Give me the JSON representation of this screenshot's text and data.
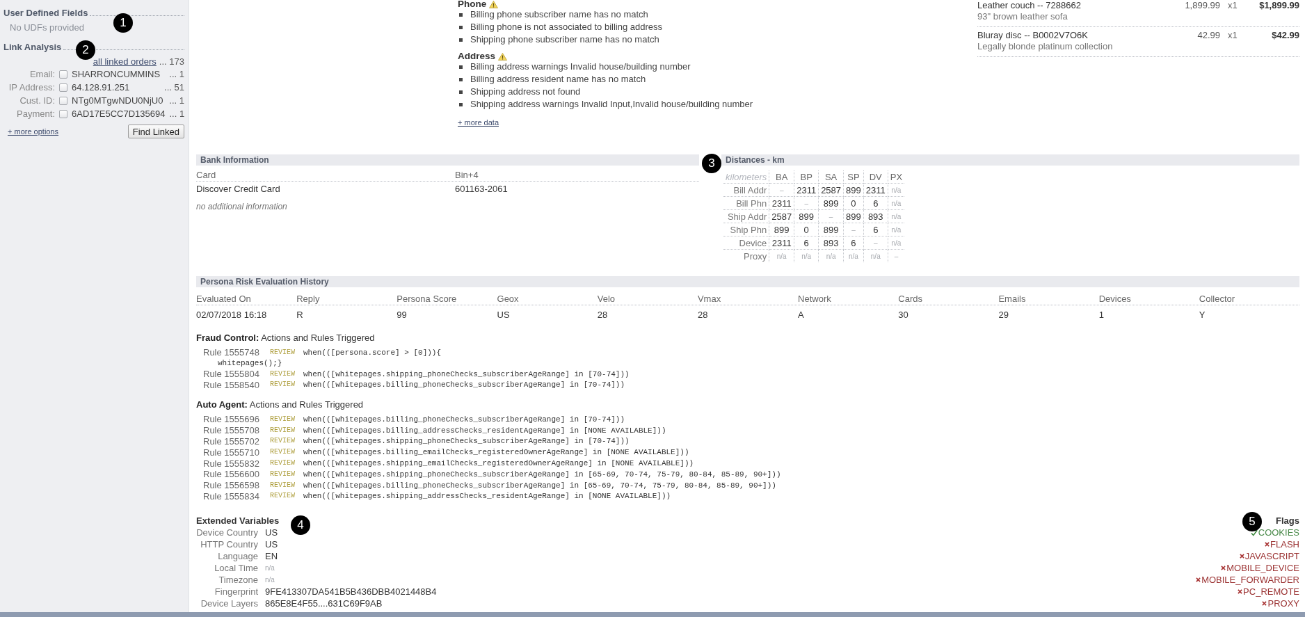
{
  "sidebar": {
    "udf": {
      "title": "User Defined Fields",
      "empty_text": "No UDFs provided"
    },
    "link_analysis": {
      "title": "Link Analysis",
      "all_link": "all linked orders",
      "all_count": "... 173",
      "rows": [
        {
          "label": "Email:",
          "checked": false,
          "value": "SHARRONCUMMINS",
          "count": "... 1"
        },
        {
          "label": "IP Address:",
          "checked": false,
          "value": "64.128.91.251",
          "count": "... 51"
        },
        {
          "label": "Cust. ID:",
          "checked": false,
          "value": "NTg0MTgwNDU0NjU0",
          "count": "... 1"
        },
        {
          "label": "Payment:",
          "checked": false,
          "value": "6AD17E5CC7D135694",
          "count": "... 1"
        }
      ],
      "more_link": "+ more options",
      "button": "Find Linked"
    }
  },
  "risk_checks": {
    "groups": [
      {
        "title": "Phone",
        "warning": true,
        "items": [
          "Billing phone subscriber name has no match",
          "Billing phone is not associated to billing address",
          "Shipping phone subscriber name has no match"
        ]
      },
      {
        "title": "Address",
        "warning": true,
        "items": [
          "Billing address warnings Invalid house/building number",
          "Billing address resident name has no match",
          "Shipping address not found",
          "Shipping address warnings Invalid Input,Invalid house/building number"
        ]
      }
    ],
    "more_link": "+ more data"
  },
  "order_items": [
    {
      "name": "Leather couch -- 7288662",
      "description": "93\" brown leather sofa",
      "price": "1,899.99",
      "qty": "x1",
      "total": "$1,899.99"
    },
    {
      "name": "Bluray disc -- B0002V7O6K",
      "description": "Legally blonde platinum collection",
      "price": "42.99",
      "qty": "x1",
      "total": "$42.99"
    }
  ],
  "bank_information": {
    "title": "Bank Information",
    "columns": [
      "Card",
      "Bin+4"
    ],
    "rows": [
      [
        "Discover Credit Card",
        "601163-2061"
      ]
    ],
    "note": "no additional information"
  },
  "distances": {
    "title": "Distances - km",
    "corner": "kilometers",
    "columns": [
      "BA",
      "BP",
      "SA",
      "SP",
      "DV",
      "PX"
    ],
    "rows": [
      {
        "label": "Bill Addr",
        "cells": [
          {
            "text": "–",
            "muted": true
          },
          {
            "text": "2311",
            "muted": false
          },
          {
            "text": "2587",
            "muted": false
          },
          {
            "text": "899",
            "muted": false
          },
          {
            "text": "2311",
            "muted": false
          },
          {
            "text": "n/a",
            "muted": true
          }
        ]
      },
      {
        "label": "Bill Phn",
        "cells": [
          {
            "text": "2311",
            "muted": false
          },
          {
            "text": "–",
            "muted": true
          },
          {
            "text": "899",
            "muted": false
          },
          {
            "text": "0",
            "muted": false
          },
          {
            "text": "6",
            "muted": false
          },
          {
            "text": "n/a",
            "muted": true
          }
        ]
      },
      {
        "label": "Ship Addr",
        "cells": [
          {
            "text": "2587",
            "muted": false
          },
          {
            "text": "899",
            "muted": false
          },
          {
            "text": "–",
            "muted": true
          },
          {
            "text": "899",
            "muted": false
          },
          {
            "text": "893",
            "muted": false
          },
          {
            "text": "n/a",
            "muted": true
          }
        ]
      },
      {
        "label": "Ship Phn",
        "cells": [
          {
            "text": "899",
            "muted": false
          },
          {
            "text": "0",
            "muted": false
          },
          {
            "text": "899",
            "muted": false
          },
          {
            "text": "–",
            "muted": true
          },
          {
            "text": "6",
            "muted": false
          },
          {
            "text": "n/a",
            "muted": true
          }
        ]
      },
      {
        "label": "Device",
        "cells": [
          {
            "text": "2311",
            "muted": false
          },
          {
            "text": "6",
            "muted": false
          },
          {
            "text": "893",
            "muted": false
          },
          {
            "text": "6",
            "muted": false
          },
          {
            "text": "–",
            "muted": true
          },
          {
            "text": "n/a",
            "muted": true
          }
        ]
      },
      {
        "label": "Proxy",
        "cells": [
          {
            "text": "n/a",
            "muted": true
          },
          {
            "text": "n/a",
            "muted": true
          },
          {
            "text": "n/a",
            "muted": true
          },
          {
            "text": "n/a",
            "muted": true
          },
          {
            "text": "n/a",
            "muted": true
          },
          {
            "text": "–",
            "muted": true
          }
        ]
      }
    ]
  },
  "persona_history": {
    "title": "Persona Risk Evaluation History",
    "columns": [
      "Evaluated On",
      "Reply",
      "Persona Score",
      "Geox",
      "Velo",
      "Vmax",
      "Network",
      "Cards",
      "Emails",
      "Devices",
      "Collector"
    ],
    "rows": [
      [
        "02/07/2018 16:18",
        "R",
        "99",
        "US",
        "28",
        "28",
        "A",
        "30",
        "29",
        "1",
        "Y"
      ]
    ]
  },
  "rule_groups": [
    {
      "title": "**Fraud Control:** Actions and Rules Triggered",
      "rules": [
        {
          "rule": "Rule 1555748",
          "action": "REVIEW",
          "code": [
            "when(([persona.score] > [0])){",
            "whitepages();}"
          ]
        },
        {
          "rule": "Rule 1555804",
          "action": "REVIEW",
          "code": [
            "when(([whitepages.shipping_phoneChecks_subscriberAgeRange] in [70-74]))"
          ]
        },
        {
          "rule": "Rule 1558540",
          "action": "REVIEW",
          "code": [
            "when(([whitepages.billing_phoneChecks_subscriberAgeRange] in [70-74]))"
          ]
        }
      ]
    },
    {
      "title": "**Auto Agent:** Actions and Rules Triggered",
      "rules": [
        {
          "rule": "Rule 1555696",
          "action": "REVIEW",
          "code": [
            "when(([whitepages.billing_phoneChecks_subscriberAgeRange] in [70-74]))"
          ]
        },
        {
          "rule": "Rule 1555708",
          "action": "REVIEW",
          "code": [
            "when(([whitepages.billing_addressChecks_residentAgeRange] in [NONE AVAILABLE]))"
          ]
        },
        {
          "rule": "Rule 1555702",
          "action": "REVIEW",
          "code": [
            "when(([whitepages.shipping_phoneChecks_subscriberAgeRange] in [70-74]))"
          ]
        },
        {
          "rule": "Rule 1555710",
          "action": "REVIEW",
          "code": [
            "when(([whitepages.billing_emailChecks_registeredOwnerAgeRange] in [NONE AVAILABLE]))"
          ]
        },
        {
          "rule": "Rule 1555832",
          "action": "REVIEW",
          "code": [
            "when(([whitepages.shipping_emailChecks_registeredOwnerAgeRange] in [NONE AVAILABLE]))"
          ]
        },
        {
          "rule": "Rule 1556600",
          "action": "REVIEW",
          "code": [
            "when(([whitepages.shipping_phoneChecks_subscriberAgeRange] in [65-69, 70-74, 75-79, 80-84, 85-89, 90+]))"
          ]
        },
        {
          "rule": "Rule 1556598",
          "action": "REVIEW",
          "code": [
            "when(([whitepages.billing_phoneChecks_subscriberAgeRange] in [65-69, 70-74, 75-79, 80-84, 85-89, 90+]))"
          ]
        },
        {
          "rule": "Rule 1555834",
          "action": "REVIEW",
          "code": [
            "when(([whitepages.shipping_addressChecks_residentAgeRange] in [NONE AVAILABLE]))"
          ]
        }
      ]
    }
  ],
  "extended_variables": {
    "title": "Extended Variables",
    "rows": [
      {
        "label": "Device Country",
        "value": "US",
        "muted": false
      },
      {
        "label": "HTTP Country",
        "value": "US",
        "muted": false
      },
      {
        "label": "Language",
        "value": "EN",
        "muted": false
      },
      {
        "label": "Local Time",
        "value": "n/a",
        "muted": true
      },
      {
        "label": "Timezone",
        "value": "n/a",
        "muted": true
      },
      {
        "label": "Fingerprint",
        "value": "9FE413307DA541B5B436DBB4021448B4",
        "muted": false
      },
      {
        "label": "Device Layers",
        "value": "865E8E4F55....631C69F9AB",
        "muted": false
      }
    ]
  },
  "flags": {
    "title": "Flags",
    "items": [
      {
        "name": "COOKIES",
        "on": true
      },
      {
        "name": "FLASH",
        "on": false
      },
      {
        "name": "JAVASCRIPT",
        "on": false
      },
      {
        "name": "MOBILE_DEVICE",
        "on": false
      },
      {
        "name": "MOBILE_FORWARDER",
        "on": false
      },
      {
        "name": "PC_REMOTE",
        "on": false
      },
      {
        "name": "PROXY",
        "on": false
      }
    ]
  },
  "callouts": [
    {
      "number": "1"
    },
    {
      "number": "2"
    },
    {
      "number": "3"
    },
    {
      "number": "4"
    },
    {
      "number": "5"
    }
  ]
}
